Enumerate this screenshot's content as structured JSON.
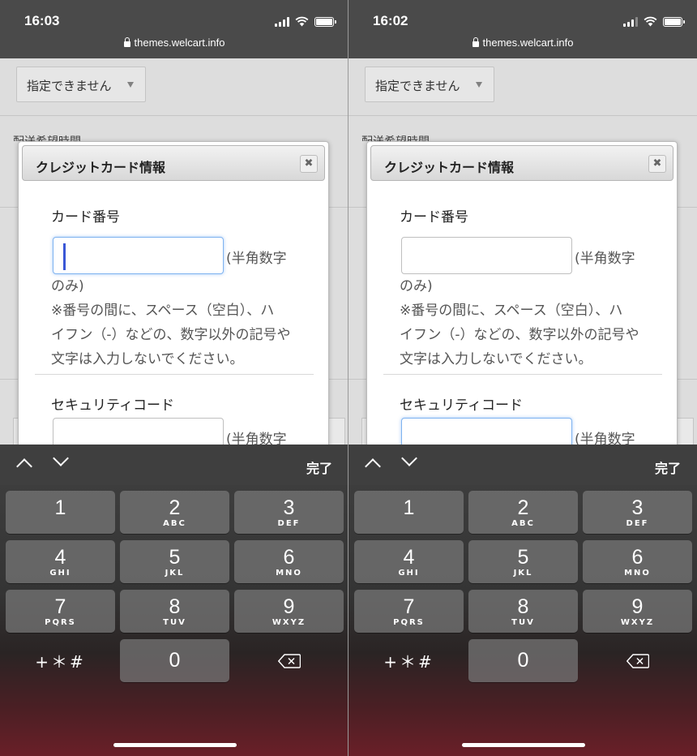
{
  "screens": [
    {
      "status": {
        "time": "16:03",
        "url": "themes.welcart.info"
      },
      "page": {
        "select_value": "指定できません",
        "behind_label": "配送希望時間"
      },
      "modal": {
        "title": "クレジットカード情報",
        "close_label": "✖",
        "card_label": "カード番号",
        "card_value": "",
        "hint_inline": "(半角数字",
        "hint_lines": [
          "のみ)",
          "※番号の間に、スペース（空白）、ハ",
          "イフン（-）などの、数字以外の記号や",
          "文字は入力しないでください。"
        ],
        "security_label": "セキュリティコード",
        "security_hint": "(半角数字",
        "focused_field": "card_number"
      },
      "keyboard": {
        "done_label": "完了",
        "keys": [
          {
            "num": "1",
            "letters": ""
          },
          {
            "num": "2",
            "letters": "ABC"
          },
          {
            "num": "3",
            "letters": "DEF"
          },
          {
            "num": "4",
            "letters": "GHI"
          },
          {
            "num": "5",
            "letters": "JKL"
          },
          {
            "num": "6",
            "letters": "MNO"
          },
          {
            "num": "7",
            "letters": "PQRS"
          },
          {
            "num": "8",
            "letters": "TUV"
          },
          {
            "num": "9",
            "letters": "WXYZ"
          },
          {
            "num": "0",
            "letters": ""
          }
        ],
        "symbols_label": "+＊#"
      }
    },
    {
      "status": {
        "time": "16:02",
        "url": "themes.welcart.info"
      },
      "page": {
        "select_value": "指定できません",
        "behind_label": "配送希望時間"
      },
      "modal": {
        "title": "クレジットカード情報",
        "close_label": "✖",
        "card_label": "カード番号",
        "card_value": "",
        "hint_inline": "(半角数字",
        "hint_lines": [
          "のみ)",
          "※番号の間に、スペース（空白）、ハ",
          "イフン（-）などの、数字以外の記号や",
          "文字は入力しないでください。"
        ],
        "security_label": "セキュリティコード",
        "security_hint": "(半角数字",
        "focused_field": "security_code"
      },
      "keyboard": {
        "done_label": "完了",
        "keys": [
          {
            "num": "1",
            "letters": ""
          },
          {
            "num": "2",
            "letters": "ABC"
          },
          {
            "num": "3",
            "letters": "DEF"
          },
          {
            "num": "4",
            "letters": "GHI"
          },
          {
            "num": "5",
            "letters": "JKL"
          },
          {
            "num": "6",
            "letters": "MNO"
          },
          {
            "num": "7",
            "letters": "PQRS"
          },
          {
            "num": "8",
            "letters": "TUV"
          },
          {
            "num": "9",
            "letters": "WXYZ"
          },
          {
            "num": "0",
            "letters": ""
          }
        ],
        "symbols_label": "+＊#"
      }
    }
  ],
  "icons": {
    "lock": "lock-icon",
    "signal": "cellular-signal-icon",
    "wifi": "wifi-icon",
    "battery": "battery-icon",
    "close": "close-icon",
    "prev": "chevron-up-icon",
    "next": "chevron-down-icon",
    "backspace": "backspace-icon"
  },
  "colors": {
    "focus_ring": "#7fb3f0",
    "caret": "#3a57d6"
  }
}
